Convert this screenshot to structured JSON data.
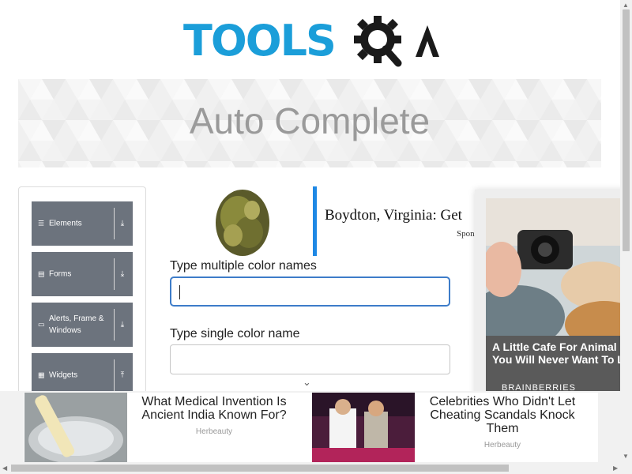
{
  "logo": {
    "text": "TOOLS",
    "alt_icon": "gear-search-icon",
    "letter": "A"
  },
  "banner": {
    "title": "Auto Complete"
  },
  "sidebar": {
    "groups": [
      {
        "label": "Elements",
        "icon": "hamburger-icon",
        "arrow": "⤓"
      },
      {
        "label": "Forms",
        "icon": "form-icon",
        "arrow": "⤓"
      },
      {
        "label": "Alerts, Frame & Windows",
        "icon": "window-icon",
        "arrow": "⤓"
      },
      {
        "label": "Widgets",
        "icon": "grid-icon",
        "arrow": "⤒"
      }
    ]
  },
  "ad_top": {
    "headline": "Boydton, Virginia: Get",
    "sponsor": "Spon"
  },
  "form": {
    "multi_label": "Type multiple color names",
    "multi_value": "",
    "single_label": "Type single color name",
    "single_value": ""
  },
  "side_ad": {
    "caption": "A Little Cafe For Animal You Will Never Want To L",
    "brand": "BRAINBERRIES"
  },
  "bottom_ads": [
    {
      "title": "What Medical Invention Is Ancient India Known For?",
      "source": "Herbeauty"
    },
    {
      "title": "Celebrities Who Didn't Let Cheating Scandals Knock Them",
      "source": "Herbeauty"
    }
  ],
  "colors": {
    "brand_blue": "#1b9ed9",
    "sidebar_gray": "#6c737d",
    "focus_blue": "#3d7cc9",
    "ad_accent": "#1e88e5"
  }
}
